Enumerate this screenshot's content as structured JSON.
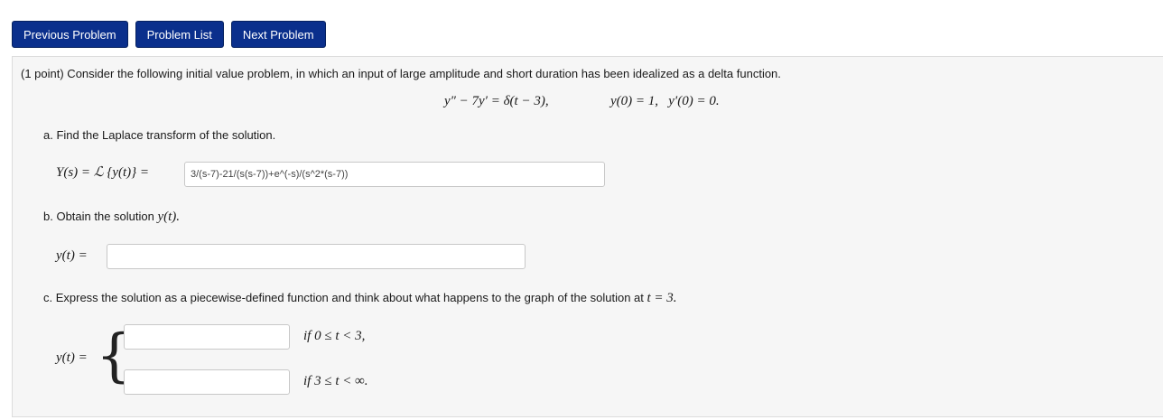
{
  "nav": {
    "previous": "Previous Problem",
    "list": "Problem List",
    "next": "Next Problem"
  },
  "problem": {
    "intro": "(1 point) Consider the following initial value problem, in which an input of large amplitude and short duration has been idealized as a delta function.",
    "equation": "y″ − 7y′ = δ(t − 3),",
    "conditions": "y(0) = 1,   y′(0) = 0.",
    "part_a": {
      "text": "a. Find the Laplace transform of the solution.",
      "label": "Y(s) = ℒ {y(t)} =",
      "value": "3/(s-7)-21/(s(s-7))+e^(-s)/(s^2*(s-7))"
    },
    "part_b": {
      "text_prefix": "b. Obtain the solution ",
      "text_math": "y(t).",
      "label": "y(t) =",
      "value": ""
    },
    "part_c": {
      "text_prefix": "c. Express the solution as a piecewise-defined function and think about what happens to the graph of the solution at ",
      "text_math": "t = 3.",
      "label": "y(t) =",
      "brace": "{",
      "piece1_value": "",
      "piece1_condition": "if  0 ≤ t < 3,",
      "piece2_value": "",
      "piece2_condition": "if  3 ≤ t < ∞."
    }
  }
}
